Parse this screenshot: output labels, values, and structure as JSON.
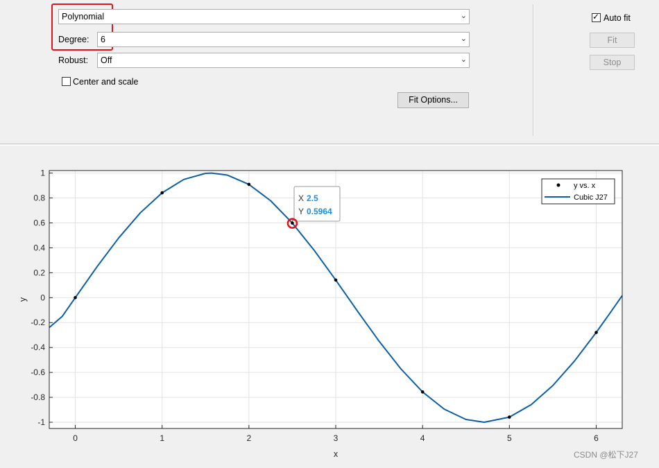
{
  "fit_type": {
    "value": "Polynomial"
  },
  "degree": {
    "label": "Degree:",
    "value": "6"
  },
  "robust": {
    "label": "Robust:",
    "value": "Off"
  },
  "center_scale": {
    "label": "Center and scale",
    "checked": false
  },
  "fit_options_button": "Fit Options...",
  "auto_fit": {
    "label": "Auto fit",
    "checked": true
  },
  "fit_button": "Fit",
  "stop_button": "Stop",
  "datatip": {
    "x_label": "X",
    "x_value": "2.5",
    "y_label": "Y",
    "y_value": "0.5964"
  },
  "watermark": "CSDN @松下J27",
  "colors": {
    "curve": "#0b5fa5",
    "datatip_value": "#1a8fe3",
    "highlight": "#e0141b"
  },
  "chart_data": {
    "type": "scatter",
    "xlabel": "x",
    "ylabel": "y",
    "xlim": [
      -0.3,
      6.3
    ],
    "ylim": [
      -1.05,
      1.02
    ],
    "xticks": [
      "0",
      "1",
      "2",
      "3",
      "4",
      "5",
      "6"
    ],
    "yticks": [
      "1",
      "0.8",
      "0.6",
      "0.4",
      "0.2",
      "0",
      "-0.2",
      "-0.4",
      "-0.6",
      "-0.8",
      "-1"
    ],
    "grid": true,
    "legend_position": "top-right",
    "series": [
      {
        "name": "y vs. x",
        "marker": "dot",
        "x": [
          0,
          1,
          2,
          2.5,
          3,
          4,
          5,
          6
        ],
        "y": [
          0,
          0.8415,
          0.9093,
          0.5985,
          0.1411,
          -0.7568,
          -0.9589,
          -0.2794
        ]
      },
      {
        "name": "Cubic J27",
        "style": "line",
        "x": [
          -0.3,
          -0.15,
          0,
          0.25,
          0.5,
          0.75,
          1,
          1.25,
          1.5,
          1.57,
          1.75,
          2,
          2.25,
          2.5,
          2.75,
          3,
          3.25,
          3.5,
          3.75,
          4,
          4.25,
          4.5,
          4.71,
          5,
          5.25,
          5.5,
          5.75,
          6,
          6.15,
          6.3
        ],
        "y": [
          -0.2398,
          -0.1494,
          0,
          0.2474,
          0.4794,
          0.6816,
          0.8415,
          0.949,
          0.9975,
          1.0,
          0.984,
          0.9093,
          0.7781,
          0.5985,
          0.3817,
          0.1411,
          -0.1082,
          -0.3508,
          -0.5716,
          -0.7568,
          -0.895,
          -0.9775,
          -1.0,
          -0.9589,
          -0.8589,
          -0.7055,
          -0.5083,
          -0.2794,
          -0.133,
          0.0168
        ]
      }
    ]
  }
}
